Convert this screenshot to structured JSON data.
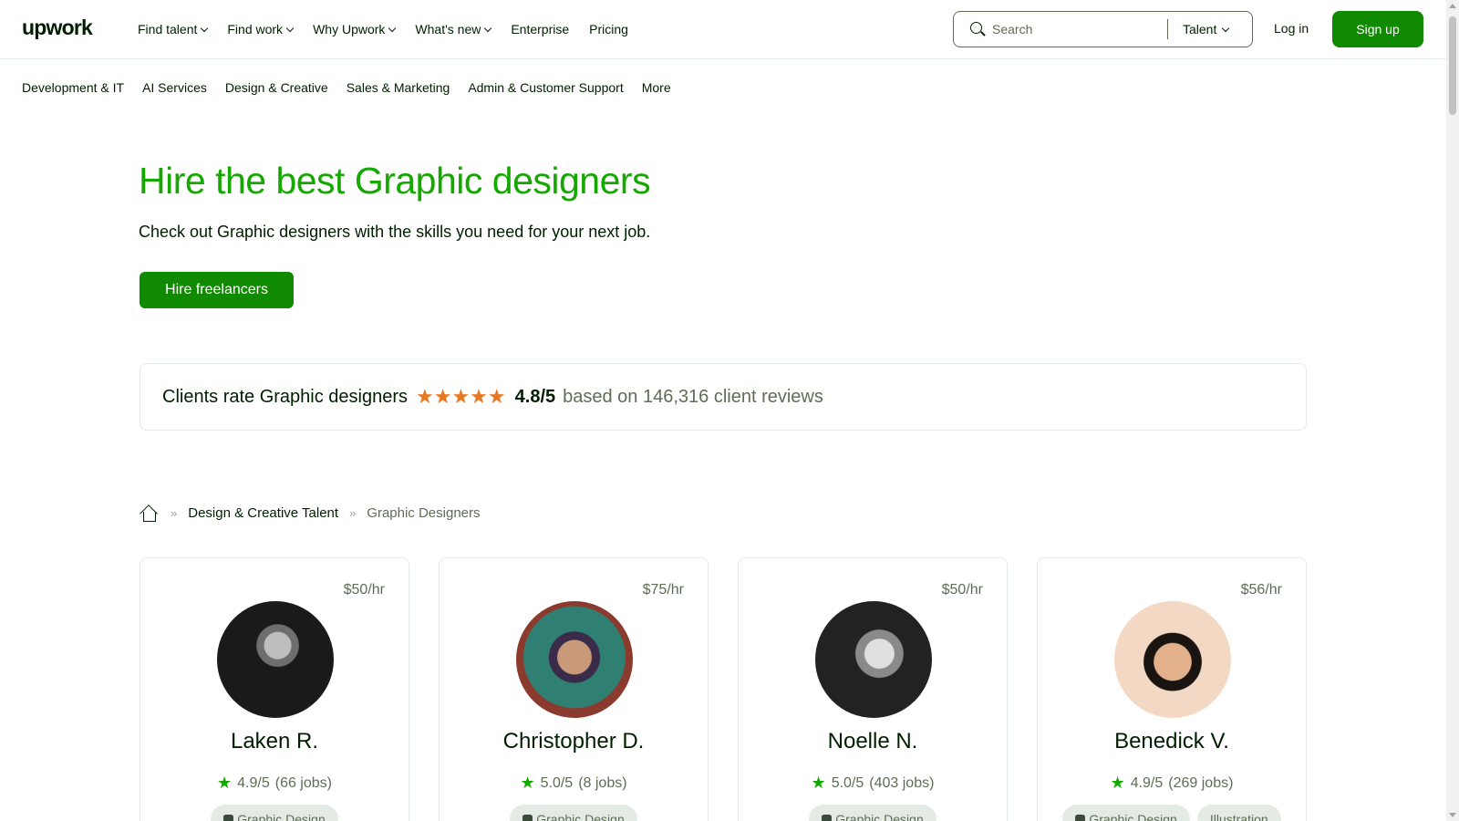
{
  "header": {
    "logo": "upwork",
    "nav": [
      {
        "label": "Find talent",
        "dropdown": true
      },
      {
        "label": "Find work",
        "dropdown": true
      },
      {
        "label": "Why Upwork",
        "dropdown": true
      },
      {
        "label": "What's new",
        "dropdown": true
      },
      {
        "label": "Enterprise",
        "dropdown": false
      },
      {
        "label": "Pricing",
        "dropdown": false
      }
    ],
    "search": {
      "placeholder": "Search",
      "value": "",
      "scope": "Talent"
    },
    "login_label": "Log in",
    "signup_label": "Sign up"
  },
  "categories": [
    "Development & IT",
    "AI Services",
    "Design & Creative",
    "Sales & Marketing",
    "Admin & Customer Support",
    "More"
  ],
  "hero": {
    "title": "Hire the best Graphic designers",
    "subtitle": "Check out Graphic designers with the skills you need for your next job.",
    "cta": "Hire freelancers"
  },
  "rating": {
    "label": "Clients rate Graphic designers",
    "stars": "★★★★★",
    "value": "4.8/5",
    "reviews": "based on 146,316 client reviews"
  },
  "breadcrumb": {
    "link": "Design & Creative Talent",
    "current": "Graphic Designers",
    "separator": "»"
  },
  "freelancers": [
    {
      "rate": "$50/hr",
      "name": "Laken R.",
      "score": "4.9/5",
      "jobs": "(66 jobs)",
      "tags": [
        "Graphic Design"
      ]
    },
    {
      "rate": "$75/hr",
      "name": "Christopher D.",
      "score": "5.0/5",
      "jobs": "(8 jobs)",
      "tags": [
        "Graphic Design"
      ]
    },
    {
      "rate": "$50/hr",
      "name": "Noelle N.",
      "score": "5.0/5",
      "jobs": "(403 jobs)",
      "tags": [
        "Graphic Design"
      ]
    },
    {
      "rate": "$56/hr",
      "name": "Benedick V.",
      "score": "4.9/5",
      "jobs": "(269 jobs)",
      "tags": [
        "Graphic Design",
        "Illustration"
      ]
    }
  ],
  "colors": {
    "brand_green": "#14a800",
    "button_green": "#108a00",
    "star_orange": "#e87722",
    "text_dark": "#001e00",
    "text_muted": "#5e6d55"
  },
  "icons": {
    "search": "search-icon",
    "chevron": "chevron-down-icon",
    "home": "home-icon",
    "star": "star-icon",
    "badge": "top-rated-badge-icon"
  }
}
